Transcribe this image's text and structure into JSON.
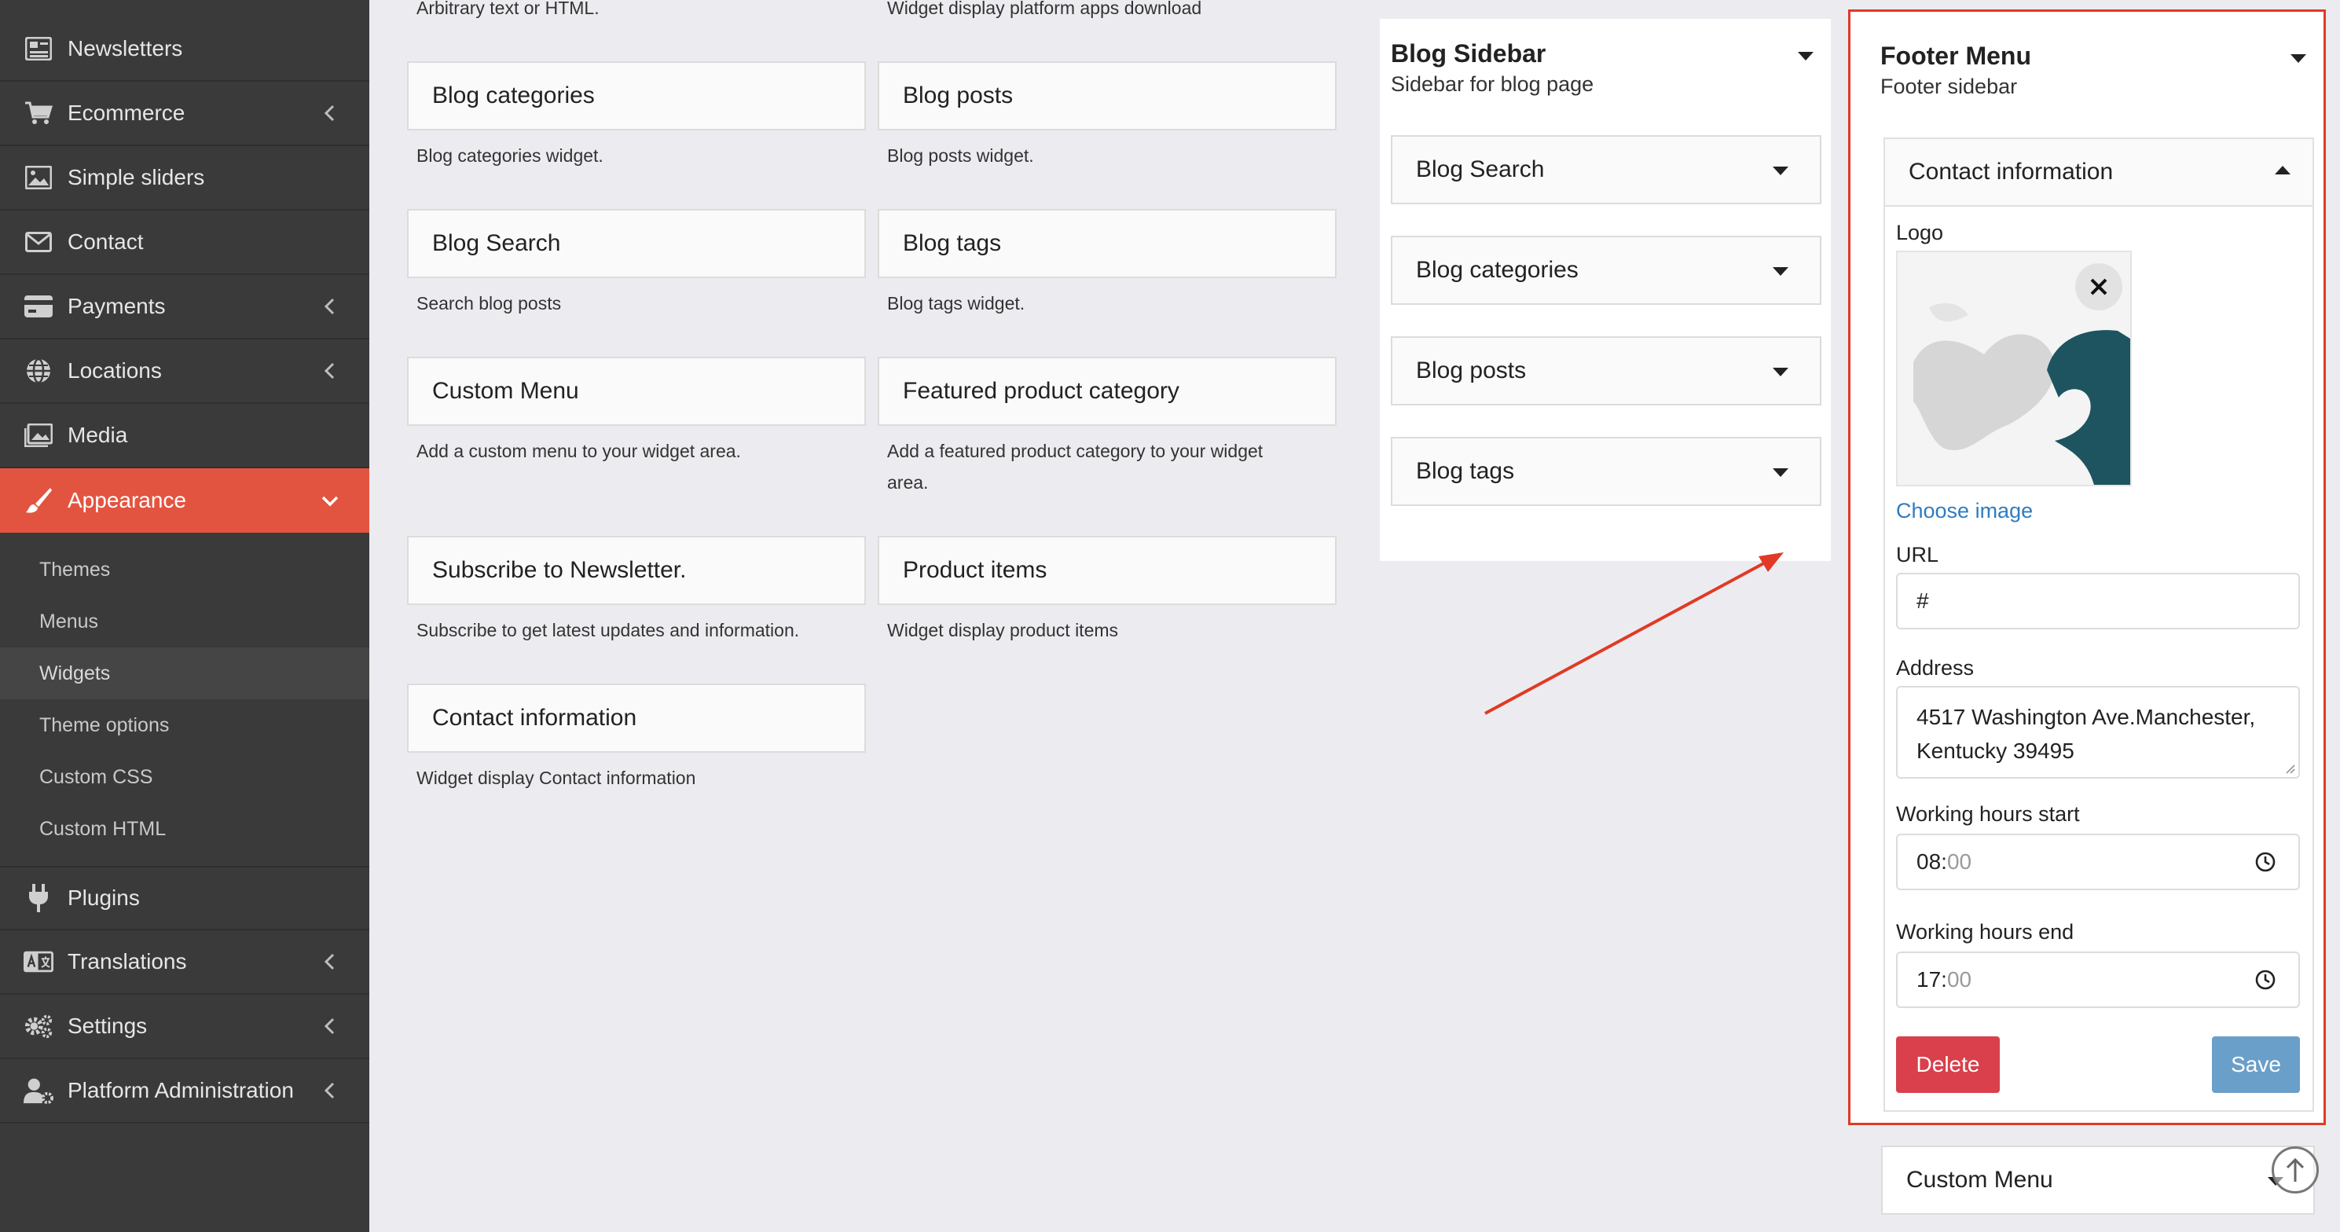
{
  "sidebar": {
    "items": [
      {
        "label": "Newsletters",
        "icon": "newspaper-icon"
      },
      {
        "label": "Ecommerce",
        "icon": "cart-icon"
      },
      {
        "label": "Simple sliders",
        "icon": "image-icon"
      },
      {
        "label": "Contact",
        "icon": "envelope-icon"
      },
      {
        "label": "Payments",
        "icon": "credit-card-icon"
      },
      {
        "label": "Locations",
        "icon": "globe-icon"
      },
      {
        "label": "Media",
        "icon": "images-icon"
      },
      {
        "label": "Appearance",
        "icon": "paintbrush-icon"
      },
      {
        "label": "Plugins",
        "icon": "plug-icon"
      },
      {
        "label": "Translations",
        "icon": "language-icon"
      },
      {
        "label": "Settings",
        "icon": "cogs-icon"
      },
      {
        "label": "Platform Administration",
        "icon": "user-cog-icon"
      }
    ],
    "appearance_sub": [
      "Themes",
      "Menus",
      "Widgets",
      "Theme options",
      "Custom CSS",
      "Custom HTML"
    ],
    "selected_sub": "Widgets",
    "active_color": "#e35440"
  },
  "available_widgets": {
    "top_desc_left": "Arbitrary text or HTML.",
    "top_desc_right": "Widget display platform apps download",
    "items": [
      {
        "title": "Blog categories",
        "desc": "Blog categories widget."
      },
      {
        "title": "Blog posts",
        "desc": "Blog posts widget."
      },
      {
        "title": "Blog Search",
        "desc": "Search blog posts"
      },
      {
        "title": "Blog tags",
        "desc": "Blog tags widget."
      },
      {
        "title": "Custom Menu",
        "desc": "Add a custom menu to your widget area."
      },
      {
        "title": "Featured product category",
        "desc_line1": "Add a featured product category to your widget",
        "desc_line2": "area."
      },
      {
        "title": "Subscribe to Newsletter.",
        "desc": "Subscribe to get latest updates and information."
      },
      {
        "title": "Product items",
        "desc": "Widget display product items"
      },
      {
        "title": "Contact information",
        "desc": "Widget display Contact information"
      }
    ]
  },
  "blog_sidebar": {
    "title": "Blog Sidebar",
    "subtitle": "Sidebar for blog page",
    "widgets": [
      "Blog Search",
      "Blog categories",
      "Blog posts",
      "Blog tags"
    ]
  },
  "footer_menu": {
    "title": "Footer Menu",
    "subtitle": "Footer sidebar",
    "highlight_color": "#e03a26",
    "contact_widget": {
      "title": "Contact information",
      "logo_label": "Logo",
      "choose_image": "Choose image",
      "url_label": "URL",
      "url_value": "#",
      "address_label": "Address",
      "address_line1": "4517 Washington Ave.Manchester,",
      "address_line2": "Kentucky 39495",
      "hours_start_label": "Working hours start",
      "hours_start_h": "08",
      "hours_start_m": "00",
      "hours_end_label": "Working hours end",
      "hours_end_h": "17",
      "hours_end_m": "00",
      "delete_label": "Delete",
      "save_label": "Save",
      "delete_color": "#d9404b",
      "save_color": "#6a9fc9"
    },
    "next_widget": "Custom Menu"
  }
}
